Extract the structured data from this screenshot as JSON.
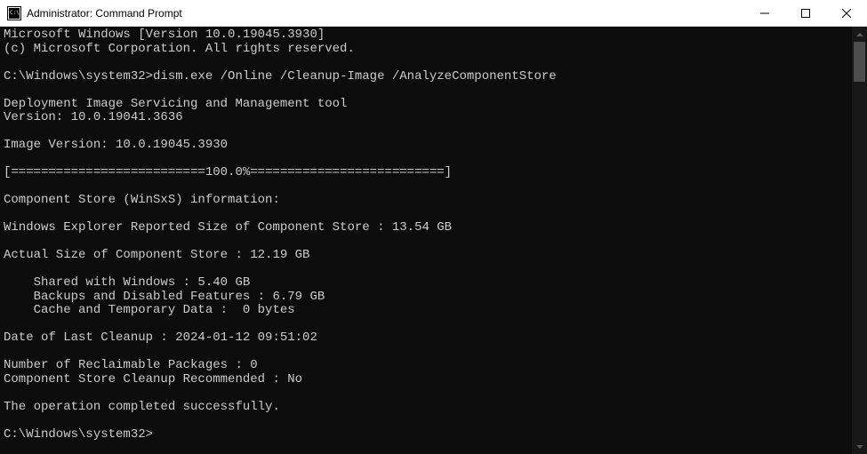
{
  "window": {
    "title": "Administrator: Command Prompt"
  },
  "console": {
    "header_line1": "Microsoft Windows [Version 10.0.19045.3930]",
    "header_line2": "(c) Microsoft Corporation. All rights reserved.",
    "prompt1": "C:\\Windows\\system32>",
    "command1": "dism.exe /Online /Cleanup-Image /AnalyzeComponentStore",
    "tool_name": "Deployment Image Servicing and Management tool",
    "tool_version": "Version: 10.0.19041.3636",
    "image_version": "Image Version: 10.0.19045.3930",
    "progress": "[==========================100.0%==========================]",
    "info_header": "Component Store (WinSxS) information:",
    "reported_size": "Windows Explorer Reported Size of Component Store : 13.54 GB",
    "actual_size": "Actual Size of Component Store : 12.19 GB",
    "shared": "    Shared with Windows : 5.40 GB",
    "backups": "    Backups and Disabled Features : 6.79 GB",
    "cache": "    Cache and Temporary Data :  0 bytes",
    "last_cleanup": "Date of Last Cleanup : 2024-01-12 09:51:02",
    "reclaimable": "Number of Reclaimable Packages : 0",
    "recommended": "Component Store Cleanup Recommended : No",
    "completed": "The operation completed successfully.",
    "prompt2": "C:\\Windows\\system32>"
  }
}
